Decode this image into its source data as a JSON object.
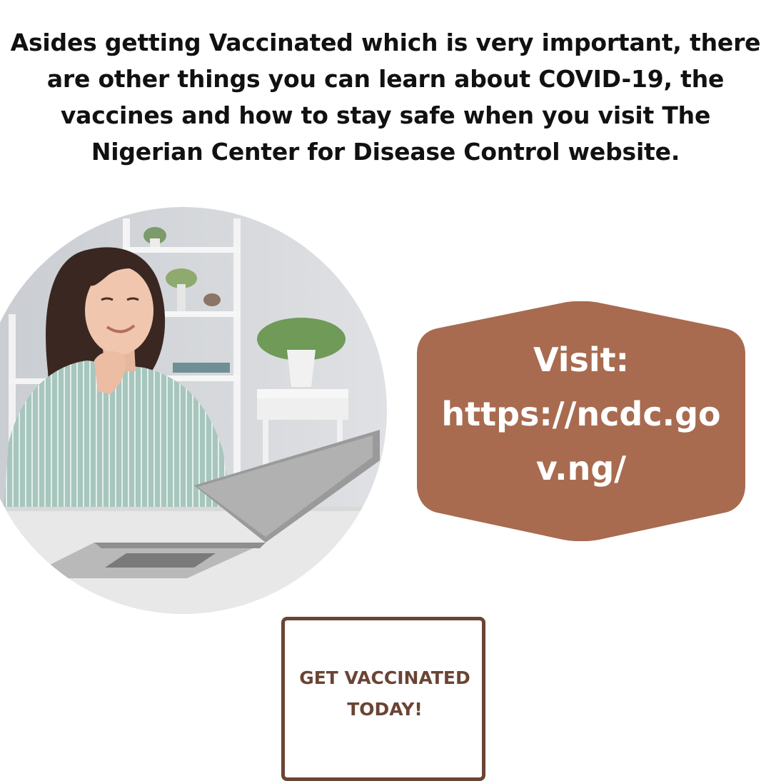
{
  "headline": {
    "lines": [
      "Asides getting Vaccinated which is very important, there",
      "are other things you can learn about COVID-19, the",
      "vaccines and how to stay safe when you visit The",
      "Nigerian Center for Disease Control website."
    ]
  },
  "visit": {
    "label": "Visit:",
    "url_line_1": "https://ncdc.go",
    "url_line_2": "v.ng/"
  },
  "cta": {
    "line_1": "GET VACCINATED",
    "line_2": "TODAY!"
  },
  "colors": {
    "accent_brown": "#a86b50",
    "dark_brown": "#6a4434",
    "text": "#111111",
    "background": "#ffffff"
  },
  "image": {
    "icon": "woman-with-laptop-photo"
  }
}
